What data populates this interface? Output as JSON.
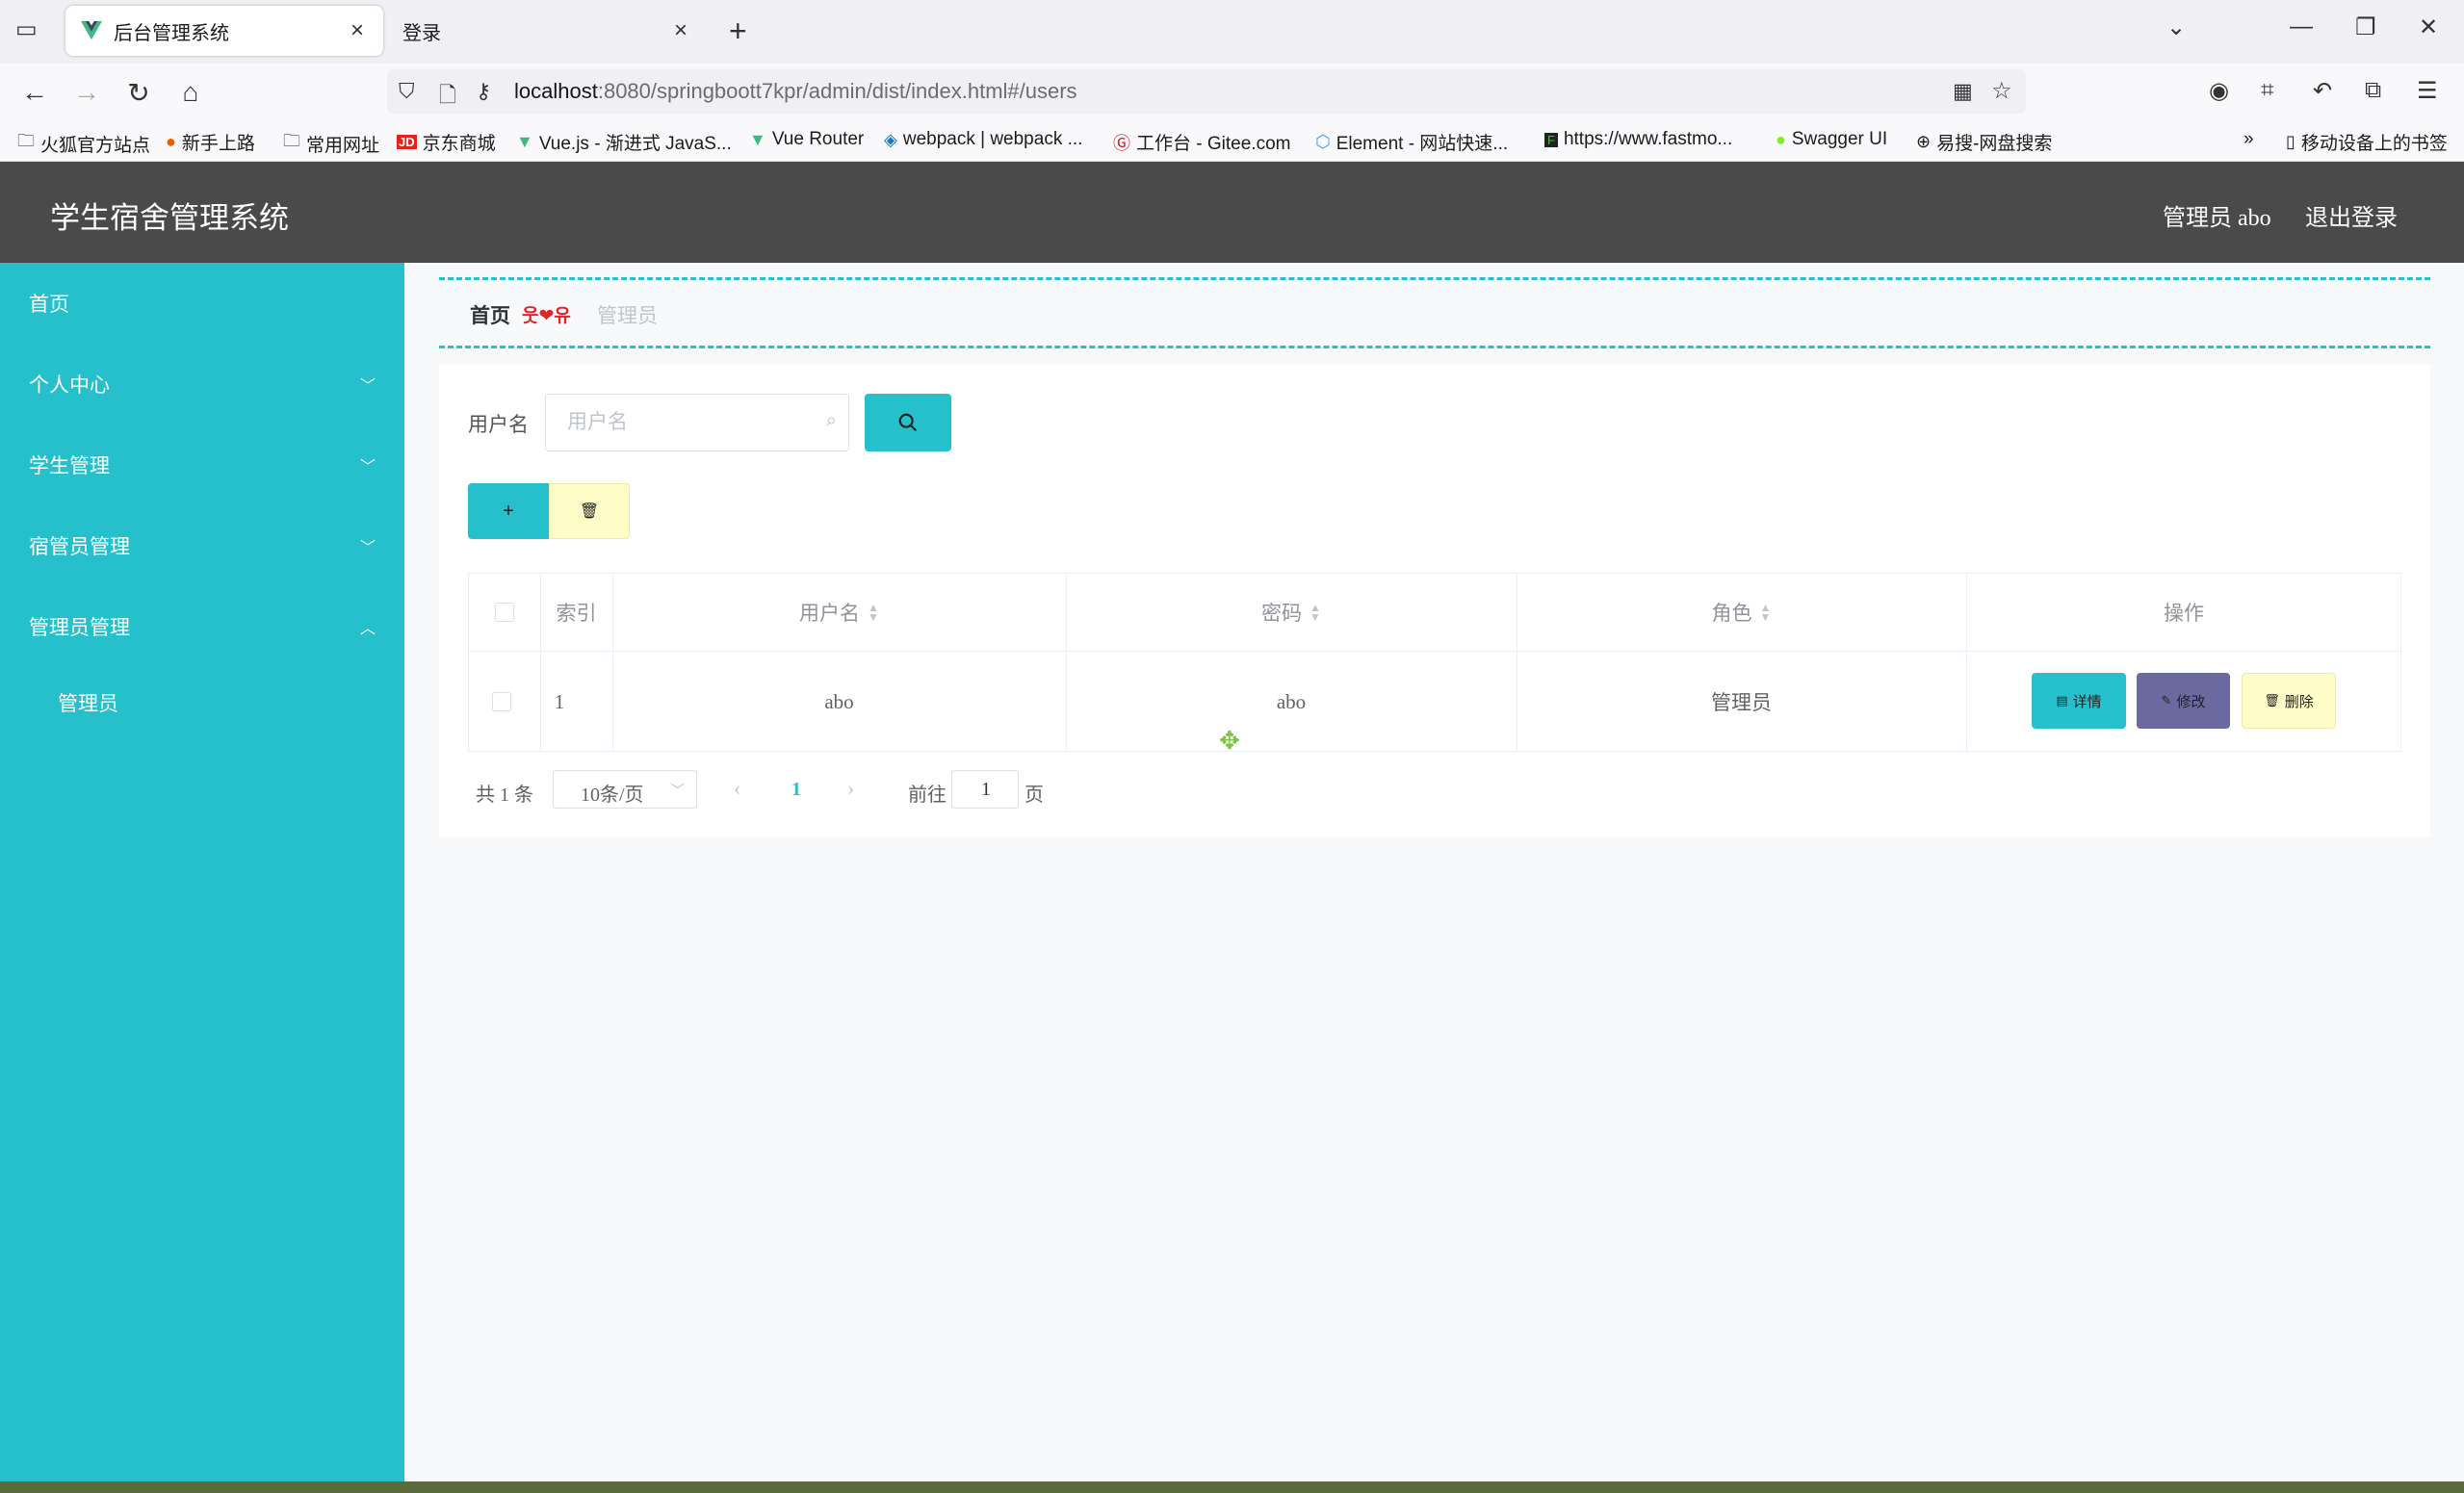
{
  "browser": {
    "tabs": [
      {
        "label": "后台管理系统",
        "active": true
      },
      {
        "label": "登录",
        "active": false
      }
    ],
    "url_host": "localhost",
    "url_path": ":8080/springboott7kpr/admin/dist/index.html#/users",
    "bookmarks": [
      {
        "icon": "folder-icon",
        "label": "火狐官方站点"
      },
      {
        "icon": "firefox-icon",
        "label": "新手上路"
      },
      {
        "icon": "folder-icon",
        "label": "常用网址"
      },
      {
        "icon": "jd-icon",
        "label": "京东商城"
      },
      {
        "icon": "vue-icon",
        "label": "Vue.js - 渐进式 JavaS..."
      },
      {
        "icon": "vue-icon",
        "label": "Vue Router"
      },
      {
        "icon": "webpack-icon",
        "label": "webpack | webpack ..."
      },
      {
        "icon": "gitee-icon",
        "label": "工作台 - Gitee.com"
      },
      {
        "icon": "element-icon",
        "label": "Element - 网站快速..."
      },
      {
        "icon": "fastmock-icon",
        "label": "https://www.fastmo..."
      },
      {
        "icon": "swagger-icon",
        "label": "Swagger UI"
      },
      {
        "icon": "globe-icon",
        "label": "易搜-网盘搜索"
      }
    ],
    "mobile_bookmarks": "移动设备上的书签"
  },
  "header": {
    "title": "学生宿舍管理系统",
    "user": "管理员 abo",
    "logout": "退出登录"
  },
  "sidebar": {
    "items": [
      {
        "label": "首页",
        "chevron": ""
      },
      {
        "label": "个人中心",
        "chevron": "down"
      },
      {
        "label": "学生管理",
        "chevron": "down"
      },
      {
        "label": "宿管员管理",
        "chevron": "down"
      },
      {
        "label": "管理员管理",
        "chevron": "up"
      }
    ],
    "subitems": [
      {
        "label": "管理员"
      }
    ]
  },
  "breadcrumb": {
    "home": "首页",
    "separator": "웃❤유",
    "current": "管理员"
  },
  "search": {
    "label": "用户名",
    "placeholder": "用户名"
  },
  "table": {
    "headers": {
      "index": "索引",
      "username": "用户名",
      "password": "密码",
      "role": "角色",
      "actions": "操作"
    },
    "rows": [
      {
        "index": "1",
        "username": "abo",
        "password": "abo",
        "role": "管理员"
      }
    ],
    "row_actions": {
      "detail": "详情",
      "edit": "修改",
      "delete": "删除"
    }
  },
  "pagination": {
    "total": "共 1 条",
    "page_size": "10条/页",
    "current_page": "1",
    "goto_label": "前往",
    "goto_value": "1",
    "page_suffix": "页"
  },
  "colors": {
    "accent": "#26c0cc",
    "header_bg": "#4a4a4a",
    "delete_bg": "#fefdc8",
    "edit_bg": "#6a6aa0",
    "breadcrumb_separator": "#e0262a"
  }
}
